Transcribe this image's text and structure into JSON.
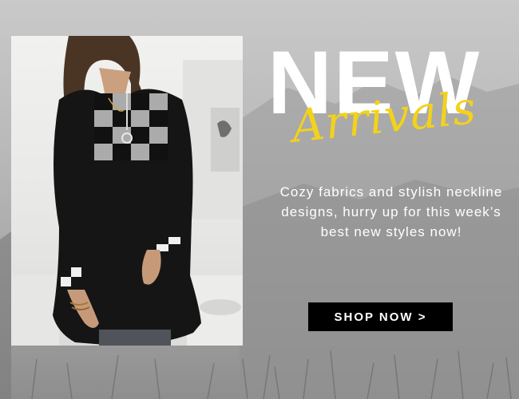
{
  "banner": {
    "headline": "NEW",
    "script_headline": "Arrivals",
    "description": "Cozy fabrics and stylish neckline designs, hurry up for this week’s best new styles now!",
    "cta_label": "SHOP NOW >",
    "colors": {
      "headline": "#ffffff",
      "script": "#f3d21b",
      "cta_background": "#000000",
      "cta_text": "#ffffff",
      "background": "#b5b5b5"
    }
  }
}
